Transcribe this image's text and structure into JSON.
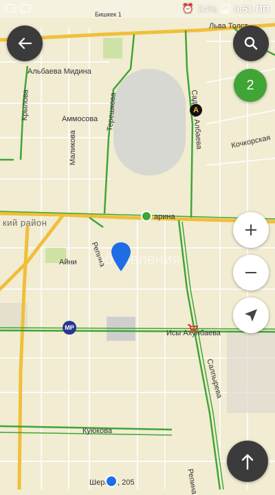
{
  "status_bar": {
    "station": "Бишкек 1",
    "battery": "24%",
    "time": "9:51 ПП"
  },
  "map": {
    "district_label": "кий район",
    "streets": {
      "lva_tolstogo": "Льва Толст",
      "albaeva_midina": "Альбаева Мидина",
      "krylova": "Крылова",
      "ammosova": "Аммосова",
      "malikova": "Маликова",
      "tereshkova": "Терешкова",
      "sadyk_albaeva": "Садыка Албаева",
      "kochkorskaya": "Кочкорская",
      "zarina": "арина",
      "repina": "Репина",
      "aini": "Айни",
      "isy_akhunbaeva": "Исы Ахунбаева",
      "salpyreva": "Салпырева",
      "kuykova": "Куюкова",
      "repina_south": "Репина",
      "sheraly": "Шерали, 205",
      "pervomay": "Первом"
    },
    "badges": {
      "metro": "МР",
      "a_marker": "A"
    },
    "cluster_count": "2",
    "watermark": "объявления"
  },
  "colors": {
    "green_road": "#3fa535",
    "yellow_road": "#f0bf3a",
    "map_bg": "#f1ecd2",
    "pin_blue": "#1e6de6"
  },
  "icons": {
    "back": "arrow-left-icon",
    "search": "search-icon",
    "zoom_in": "plus-icon",
    "zoom_out": "minus-icon",
    "locate": "navigation-arrow-icon",
    "scroll_top": "arrow-up-icon"
  }
}
